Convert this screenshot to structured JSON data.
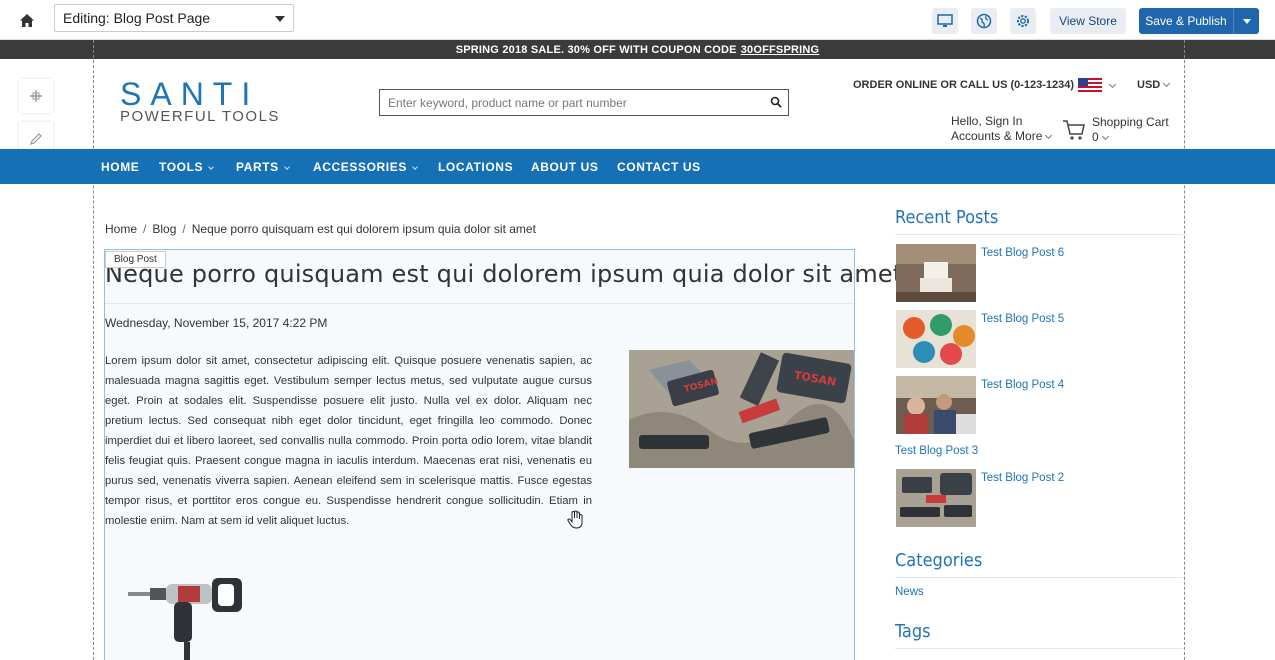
{
  "editor": {
    "page_select_value": "Editing: Blog Post Page",
    "view_store_label": "View Store",
    "publish_label": "Save & Publish"
  },
  "promo": {
    "text": "SPRING 2018 SALE. 30% OFF WITH COUPON CODE",
    "code": "30OFFSPRING"
  },
  "header": {
    "logo_main": "SANTI",
    "logo_sub": "POWERFUL TOOLS",
    "search_placeholder": "Enter keyword, product name or part number",
    "order_text": "ORDER ONLINE OR CALL US (0-123-1234)",
    "currency": "USD",
    "account_line1": "Hello, Sign In",
    "account_line2": "Accounts & More",
    "cart_label": "Shopping Cart",
    "cart_count": "0"
  },
  "nav": {
    "items": [
      {
        "label": "HOME"
      },
      {
        "label": "TOOLS"
      },
      {
        "label": "PARTS"
      },
      {
        "label": "ACCESSORIES"
      },
      {
        "label": "LOCATIONS"
      },
      {
        "label": "ABOUT US"
      },
      {
        "label": "CONTACT US"
      }
    ]
  },
  "breadcrumb": {
    "items": [
      "Home",
      "Blog",
      "Neque porro quisquam est qui dolorem ipsum quia dolor sit amet"
    ]
  },
  "post": {
    "region_tag": "Blog Post",
    "title": "Neque porro quisquam est qui dolorem ipsum quia dolor sit amet",
    "date": "Wednesday, November 15, 2017 4:22 PM",
    "body": "Lorem ipsum dolor sit amet, consectetur adipiscing elit. Quisque posuere venenatis sapien, ac malesuada magna sagittis eget. Vestibulum semper lectus metus, sed vulputate augue cursus eget. Proin at sodales elit. Suspendisse posuere elit justo. Nulla vel ex dolor. Aliquam nec pretium lectus. Sed consequat nibh eget dolor tincidunt, eget fringilla leo commodo. Donec imperdiet dui et libero laoreet, sed convallis nulla commodo. Proin porta odio lorem, vitae blandit felis feugiat quis. Praesent congue magna in iaculis interdum. Maecenas erat nisi, venenatis eu purus sed, venenatis viverra sapien. Aenean eleifend sem in scelerisque mattis. Fusce egestas tempor risus, et porttitor eros congue eu. Suspendisse hendrerit congue sollicitudin. Etiam in molestie enim. Nam at sem id velit aliquet luctus.",
    "image_text": "TOSAN"
  },
  "sidebar": {
    "recent_heading": "Recent Posts",
    "recent_posts": [
      {
        "title": "Test Blog Post 6"
      },
      {
        "title": "Test Blog Post 5"
      },
      {
        "title": "Test Blog Post 4"
      },
      {
        "title": "Test Blog Post 3"
      },
      {
        "title": "Test Blog Post 2"
      }
    ],
    "categories_heading": "Categories",
    "categories": [
      "News"
    ],
    "tags_heading": "Tags"
  },
  "colors": {
    "brand_blue": "#1670b6",
    "link_blue": "#1e74b9",
    "publish_blue": "#1f66ad",
    "promo_bg": "#3b3b3b"
  }
}
